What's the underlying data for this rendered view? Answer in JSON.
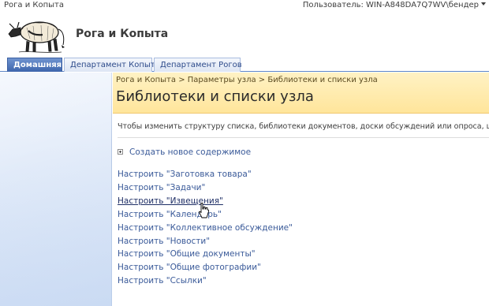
{
  "topbar": {
    "site_name": "Рога и Копыта",
    "user_label": "Пользователь: WIN-A848DA7Q7WV\\бендер"
  },
  "header": {
    "title": "Рога и Копыта"
  },
  "tabs": [
    {
      "label": "Домашняя",
      "active": true
    },
    {
      "label": "Департамент Копыт",
      "active": false
    },
    {
      "label": "Департамент Рогов",
      "active": false
    }
  ],
  "breadcrumb": {
    "items": [
      "Рога и Копыта",
      "Параметры узла",
      "Библиотеки и списки узла"
    ],
    "separator": ">"
  },
  "page": {
    "title": "Библиотеки и списки узла",
    "description": "Чтобы изменить структуру списка, библиотеки документов, доски обсуждений или опроса, щелкни",
    "create_label": "Создать новое содержимое"
  },
  "links": [
    "Настроить \"Заготовка товара\"",
    "Настроить \"Задачи\"",
    "Настроить \"Извещения\"",
    "Настроить \"Календарь\"",
    "Настроить \"Коллективное обсуждение\"",
    "Настроить \"Новости\"",
    "Настроить \"Общие документы\"",
    "Настроить \"Общие фотографии\"",
    "Настроить \"Ссылки\""
  ],
  "hovered_link_index": 2,
  "colors": {
    "link": "#3a5a99",
    "tab_active": "#3d65ac",
    "title_area": "#ffe59b"
  }
}
